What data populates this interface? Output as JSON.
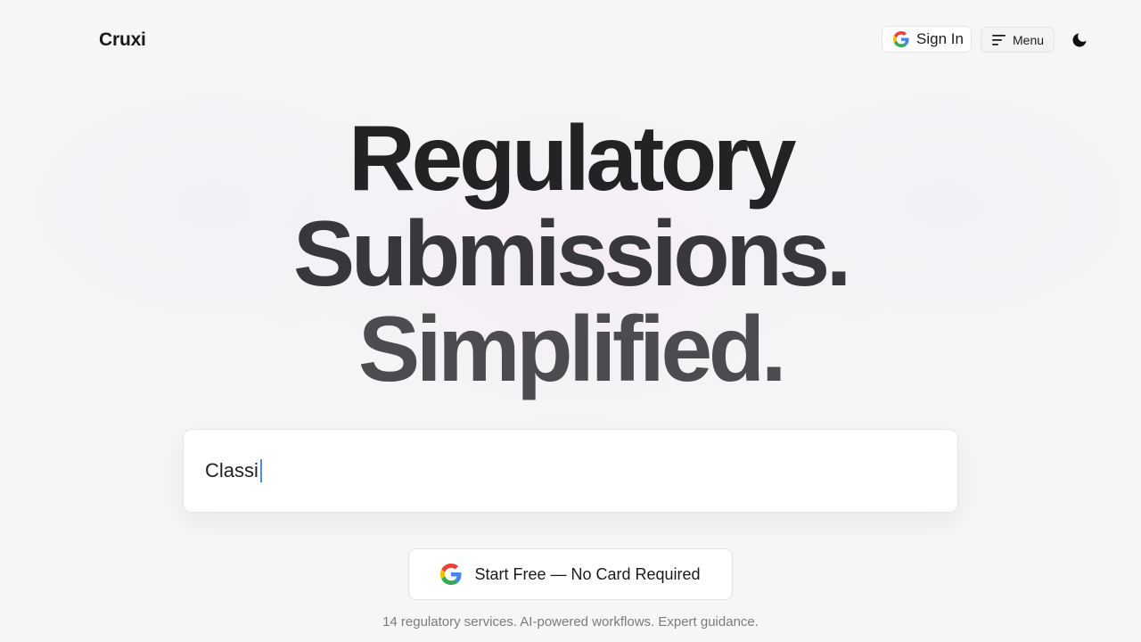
{
  "header": {
    "logo": "Cruxi",
    "signin_label": "Sign In",
    "menu_label": "Menu"
  },
  "hero": {
    "line1": "Regulatory",
    "line2": "Submissions.",
    "line3": "Simplified."
  },
  "prompt_input": {
    "value": "Classi"
  },
  "cta": {
    "label": "Start Free — No Card Required"
  },
  "tagline": "14 regulatory services. AI-powered workflows. Expert guidance.",
  "icons": {
    "signin": "google-icon",
    "menu": "menu-lines-icon",
    "theme": "moon-icon",
    "cta": "google-icon"
  },
  "colors": {
    "google_blue": "#4285F4",
    "google_red": "#EA4335",
    "google_yellow": "#FBBC05",
    "google_green": "#34A853",
    "caret": "#4a90d9"
  }
}
